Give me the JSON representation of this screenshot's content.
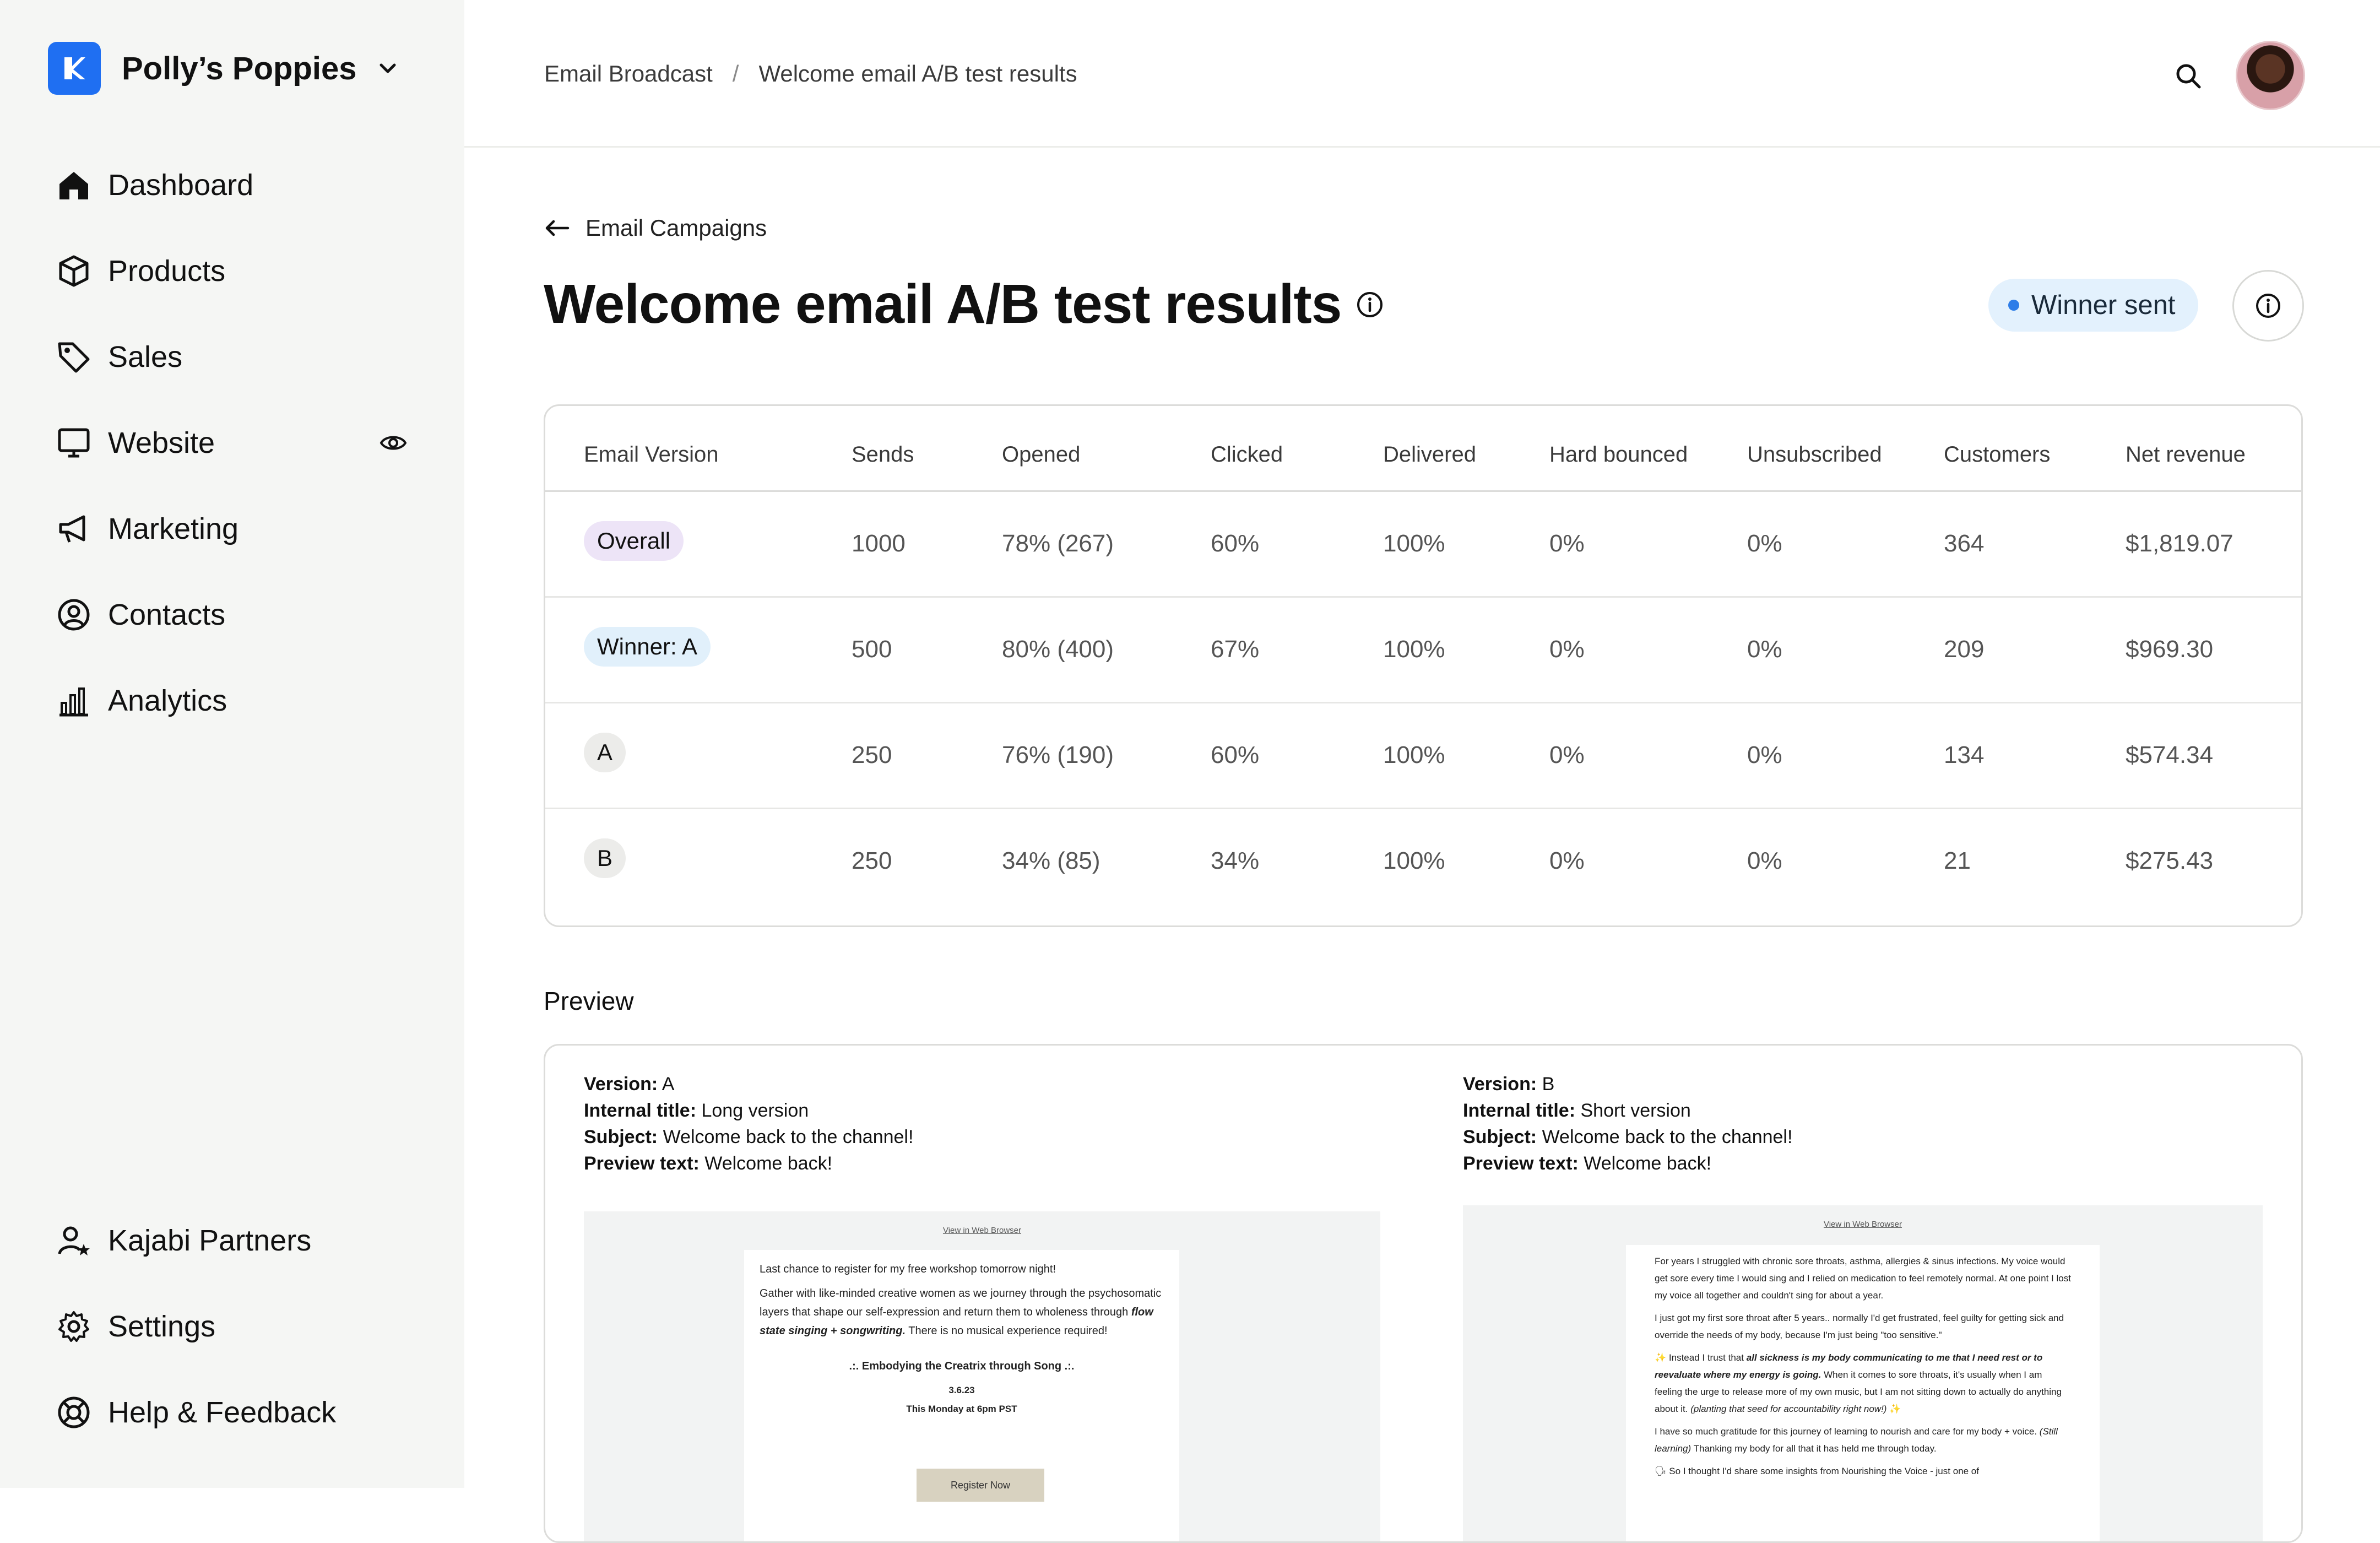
{
  "brand": {
    "name": "Polly’s Poppies"
  },
  "sidebar": {
    "items": [
      {
        "label": "Dashboard",
        "icon": "home-icon"
      },
      {
        "label": "Products",
        "icon": "box-icon"
      },
      {
        "label": "Sales",
        "icon": "tag-icon"
      },
      {
        "label": "Website",
        "icon": "monitor-icon"
      },
      {
        "label": "Marketing",
        "icon": "megaphone-icon"
      },
      {
        "label": "Contacts",
        "icon": "user-circle-icon"
      },
      {
        "label": "Analytics",
        "icon": "bar-chart-icon"
      }
    ],
    "bottom": [
      {
        "label": "Kajabi Partners",
        "icon": "partner-icon"
      },
      {
        "label": "Settings",
        "icon": "gear-icon"
      },
      {
        "label": "Help & Feedback",
        "icon": "lifebuoy-icon"
      }
    ]
  },
  "header": {
    "breadcrumb": [
      "Email Broadcast",
      "Welcome email A/B test results"
    ]
  },
  "page": {
    "back_label": "Email Campaigns",
    "title": "Welcome email A/B test results",
    "status": "Winner sent"
  },
  "colors": {
    "brand": "#1f6ff2",
    "status_dot": "#2e7de8"
  },
  "table": {
    "columns": [
      "Email Version",
      "Sends",
      "Opened",
      "Clicked",
      "Delivered",
      "Hard bounced",
      "Unsubscribed",
      "Customers",
      "Net revenue"
    ],
    "rows": [
      {
        "version": "Overall",
        "sends": "1000",
        "opened": "78% (267)",
        "clicked": "60%",
        "delivered": "100%",
        "hard_bounced": "0%",
        "unsubscribed": "0%",
        "customers": "364",
        "net_revenue": "$1,819.07"
      },
      {
        "version": "Winner: A",
        "sends": "500",
        "opened": "80% (400)",
        "clicked": "67%",
        "delivered": "100%",
        "hard_bounced": "0%",
        "unsubscribed": "0%",
        "customers": "209",
        "net_revenue": "$969.30"
      },
      {
        "version": "A",
        "sends": "250",
        "opened": "76% (190)",
        "clicked": "60%",
        "delivered": "100%",
        "hard_bounced": "0%",
        "unsubscribed": "0%",
        "customers": "134",
        "net_revenue": "$574.34"
      },
      {
        "version": "B",
        "sends": "250",
        "opened": "34% (85)",
        "clicked": "34%",
        "delivered": "100%",
        "hard_bounced": "0%",
        "unsubscribed": "0%",
        "customers": "21",
        "net_revenue": "$275.43"
      }
    ]
  },
  "preview": {
    "label": "Preview",
    "field_labels": {
      "version": "Version:",
      "internal_title": "Internal title:",
      "subject": "Subject:",
      "preview_text": "Preview text:"
    },
    "versions": [
      {
        "version": "A",
        "internal_title": "Long version",
        "subject": "Welcome back to the channel!",
        "preview_text": "Welcome back!",
        "email": {
          "web_link": "View in Web Browser",
          "p1": "Last chance to register for my free workshop tomorrow night!",
          "p2a": "Gather with like-minded creative women as we journey through the psychosomatic layers that shape our self-expression and return them to wholeness through ",
          "p2b": "flow state singing + songwriting.",
          "p2c": " There is no musical experience required!",
          "event_title": ".:. Embodying the Creatrix through Song .:.",
          "event_date": "3.6.23",
          "event_time": "This Monday at 6pm PST",
          "cta": "Register Now"
        }
      },
      {
        "version": "B",
        "internal_title": "Short version",
        "subject": "Welcome back to the channel!",
        "preview_text": "Welcome back!",
        "email": {
          "web_link": "View in Web Browser",
          "p1": "For years I struggled with chronic sore throats, asthma, allergies & sinus infections. My voice would get sore every time I would sing and I relied on medication to feel remotely normal. At one point I lost my voice all together and couldn't sing for about a year.",
          "p2": "I just got my first sore throat after 5 years.. normally I'd get frustrated, feel guilty for getting sick and override the needs of my body, because I'm just being \"too sensitive.\"",
          "p3a": "✨ Instead I trust that ",
          "p3b": "all sickness is my body communicating to me that I need rest or to reevaluate where my energy is going.",
          "p3c": " When it comes to sore throats, it's usually when I am feeling the urge to release more of my own music, but I am not sitting down to actually do anything about it. ",
          "p3d": "(planting that seed for accountability right now!)",
          "p3e": " ✨",
          "p4a": "I have so much gratitude for this journey of learning to nourish and care for my body + voice. ",
          "p4b": "(Still learning)",
          "p4c": " Thanking my body for all that it has held me through today.",
          "p5": "🗣 So I thought I'd share some insights from Nourishing the Voice - just one of"
        }
      }
    ]
  }
}
